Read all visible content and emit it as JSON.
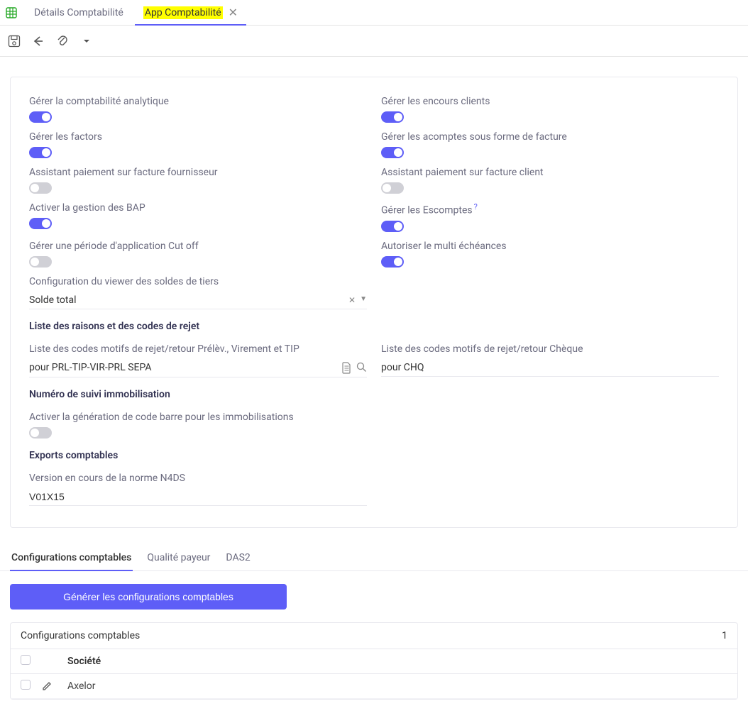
{
  "top_tabs": {
    "inactive": "Détails Comptabilité",
    "active": "App Comptabilité"
  },
  "fields": {
    "analytic": {
      "label": "Gérer la comptabilité analytique",
      "on": true
    },
    "factors": {
      "label": "Gérer les factors",
      "on": true
    },
    "assistSupplier": {
      "label": "Assistant paiement sur facture fournisseur",
      "on": false
    },
    "bap": {
      "label": "Activer la gestion des BAP",
      "on": true
    },
    "cutoff": {
      "label": "Gérer une période d'application Cut off",
      "on": false
    },
    "viewerConfig": {
      "label": "Configuration du viewer des soldes de tiers",
      "value": "Solde total"
    },
    "custCredit": {
      "label": "Gérer les encours clients",
      "on": true
    },
    "advanceInvoice": {
      "label": "Gérer les acomptes sous forme de facture",
      "on": true
    },
    "assistCustomer": {
      "label": "Assistant paiement sur facture client",
      "on": false
    },
    "discounts": {
      "label": "Gérer les Escomptes",
      "on": true,
      "help": "?"
    },
    "multiDue": {
      "label": "Autoriser le multi échéances",
      "on": true
    }
  },
  "rejectSection": {
    "title": "Liste des raisons et des codes de rejet",
    "left": {
      "label": "Liste des codes motifs de rejet/retour Prélèv., Virement et TIP",
      "value": "pour PRL-TIP-VIR-PRL SEPA"
    },
    "right": {
      "label": "Liste des codes motifs de rejet/retour Chèque",
      "value": "pour CHQ"
    }
  },
  "assetSection": {
    "title": "Numéro de suivi immobilisation",
    "barcode": {
      "label": "Activer la génération de code barre pour les immobilisations",
      "on": false
    }
  },
  "exportSection": {
    "title": "Exports comptables",
    "n4ds": {
      "label": "Version en cours de la norme N4DS",
      "value": "V01X15"
    }
  },
  "subtabs": {
    "t1": "Configurations comptables",
    "t2": "Qualité payeur",
    "t3": "DAS2"
  },
  "genBtn": "Générer les configurations comptables",
  "grid": {
    "title": "Configurations comptables",
    "count": "1",
    "colCompany": "Société",
    "rows": [
      {
        "company": "Axelor"
      }
    ]
  }
}
